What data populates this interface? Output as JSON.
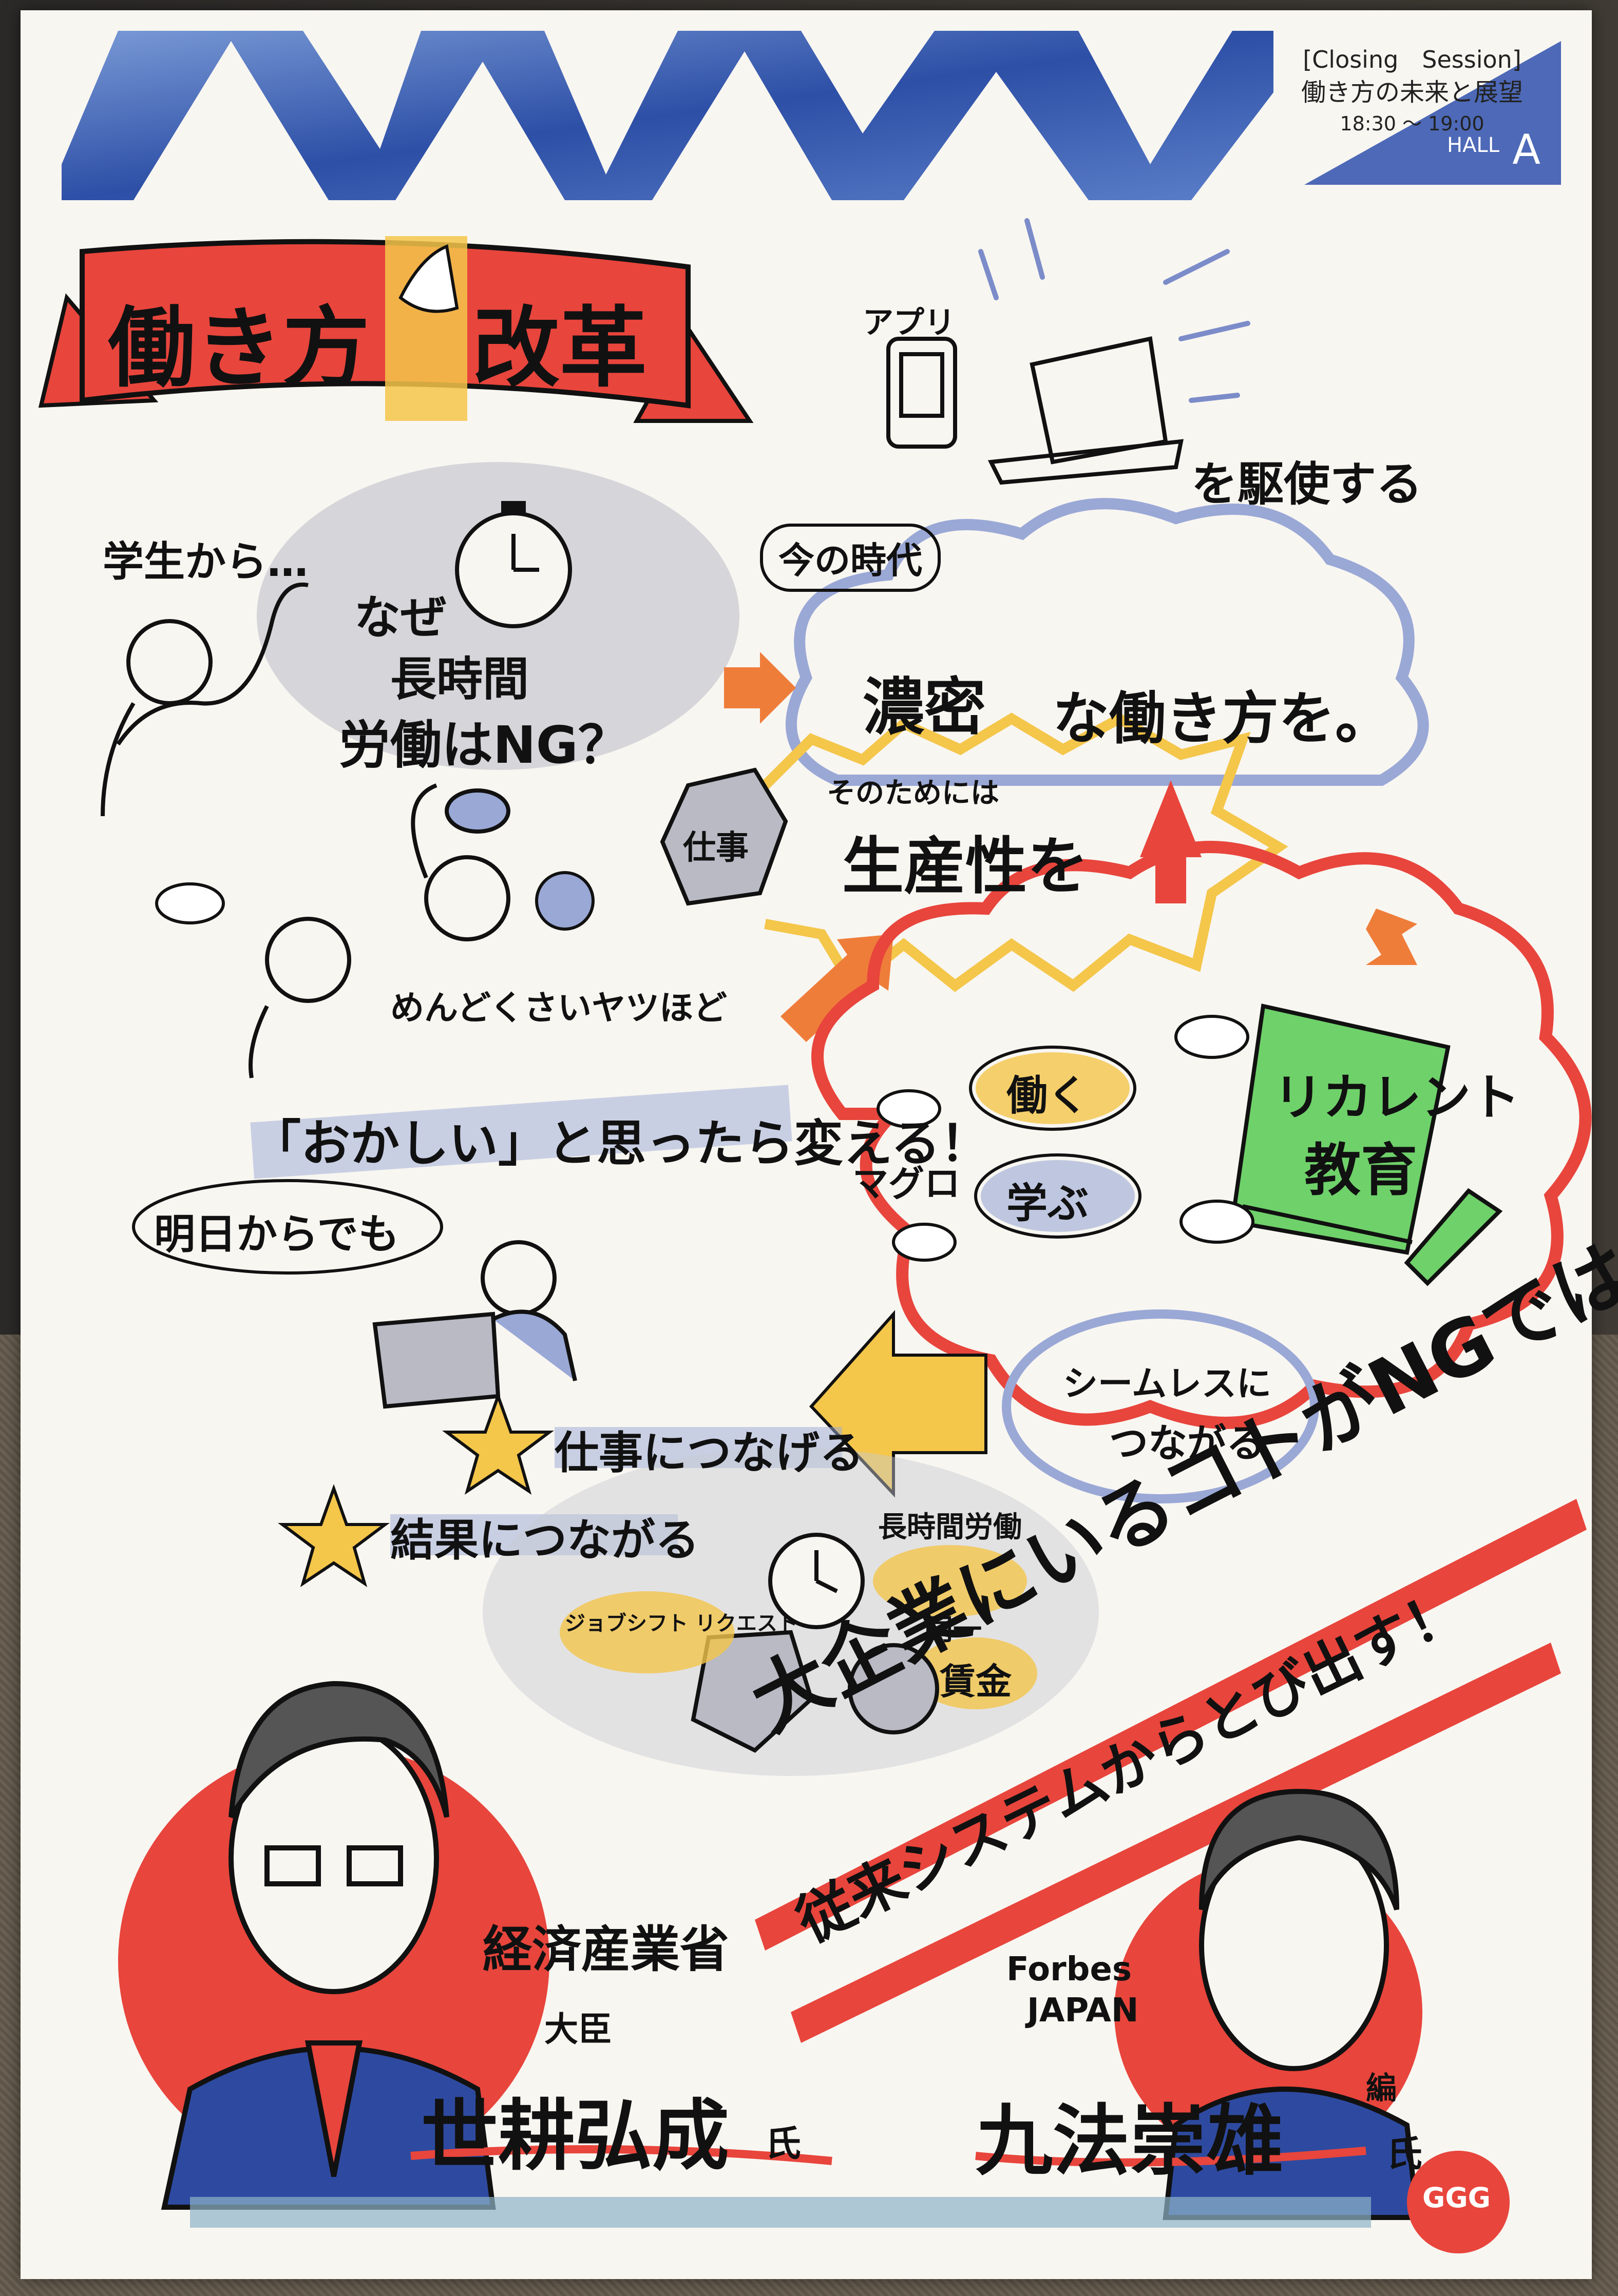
{
  "header": {
    "session_label": "[Closing　Session]",
    "session_title": "働き方の未来と展望",
    "time": "18:30 〜 19:00",
    "hall_word": "HALL",
    "hall_letter": "A"
  },
  "title_banner": {
    "left": "働き方",
    "right": "改革"
  },
  "texts": {
    "app_label": "アプリ",
    "kushi": "を駆使する",
    "student": "学生から…",
    "naze": "なぜ",
    "chojikan": "長時間",
    "rodo": "労働はNG？",
    "ima_jidai": "今の時代",
    "nomitsu": "濃密",
    "hatarakikata_wo": "な働き方を。",
    "shigoto": "仕事",
    "sono_tame": "そのためには",
    "seisansei": "生産性を",
    "mendokusai": "めんどくさいヤツほど",
    "okashii": "「おかしい」と思ったら変える！",
    "ashita": "明日からでも",
    "hataraku": "働く",
    "magura": "マグロ",
    "manabu": "学ぶ",
    "recurrent_1": "リカレント",
    "recurrent_2": "教育",
    "shigoto_tsunageru": "仕事につなげる",
    "kekka_tsunagaru": "結果につながる",
    "seamless_1": "シームレスに",
    "seamless_2": "つながる",
    "chojikan_rodo": "長時間労働",
    "job_shift": "ジョブシフト リクエスト",
    "doitsu": "同一",
    "chingin": "賃金",
    "daikigyo": "大企業にいるコトがNGではない！",
    "jurai": "従来システムからとび出す！",
    "meti": "経済産業省",
    "daijin": "大臣",
    "seko": "世耕弘成",
    "shi1": "氏",
    "forbes": "Forbes",
    "japan": "JAPAN",
    "hen": "編",
    "kuho": "九法崇雄",
    "shi2": "氏",
    "logo": "GGG"
  },
  "colors": {
    "red": "#e8453c",
    "yellow": "#f4c64a",
    "blue_wash": "#9aa8d6",
    "green": "#6fd16a",
    "orange": "#ef7d3a",
    "navy": "#2e4aa0"
  }
}
